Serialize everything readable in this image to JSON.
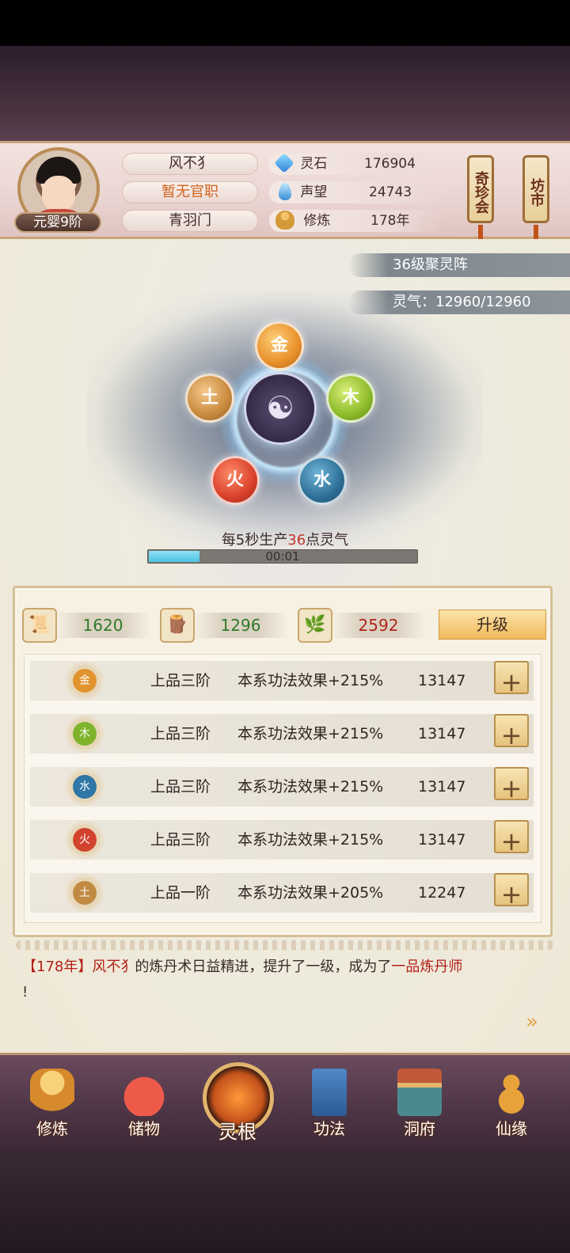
{
  "player": {
    "name": "风不犭",
    "official_rank": "暂无官职",
    "sect": "青羽门",
    "realm": "元婴9阶"
  },
  "resources": {
    "lingshi_label": "灵石",
    "lingshi_value": "176904",
    "shengwang_label": "声望",
    "shengwang_value": "24743",
    "xiulian_label": "修炼",
    "xiulian_value": "178年"
  },
  "side_buttons": {
    "qizhenhui": "奇珍会",
    "fangshi": "坊市"
  },
  "array": {
    "level_label": "36级聚灵阵",
    "qi_label": "灵气：12960/12960",
    "produce_prefix": "每5秒生产",
    "produce_amount": "36",
    "produce_suffix": "点灵气",
    "timer": "00:01",
    "timer_progress": 0.19,
    "elements": {
      "jin": "金",
      "mu": "木",
      "shui": "水",
      "huo": "火",
      "tu": "土"
    }
  },
  "upgrade": {
    "cost1": "1620",
    "cost2": "1296",
    "cost3": "2592",
    "button": "升级",
    "colors": {
      "ok": "#2f7a2a",
      "short": "#b1251d"
    }
  },
  "roots": [
    {
      "element": "金",
      "grade": "上品三阶",
      "effect": "本系功法效果+215%",
      "value": "13147",
      "color": "#e1942e"
    },
    {
      "element": "木",
      "grade": "上品三阶",
      "effect": "本系功法效果+215%",
      "value": "13147",
      "color": "#7fb32b"
    },
    {
      "element": "水",
      "grade": "上品三阶",
      "effect": "本系功法效果+215%",
      "value": "13147",
      "color": "#2f77a6"
    },
    {
      "element": "火",
      "grade": "上品三阶",
      "effect": "本系功法效果+215%",
      "value": "13147",
      "color": "#d2432e"
    },
    {
      "element": "土",
      "grade": "上品一阶",
      "effect": "本系功法效果+205%",
      "value": "12247",
      "color": "#c08a43"
    }
  ],
  "log": {
    "year": "【178年】",
    "name": "风不犭",
    "text_mid": "的炼丹术日益精进，提升了一级，成为了",
    "title": "一品炼丹师",
    "end": "!"
  },
  "nav": {
    "xiulian": "修炼",
    "chuwu": "储物",
    "linggen": "灵根",
    "gongfa": "功法",
    "dongfu": "洞府",
    "xianyuan": "仙缘"
  }
}
